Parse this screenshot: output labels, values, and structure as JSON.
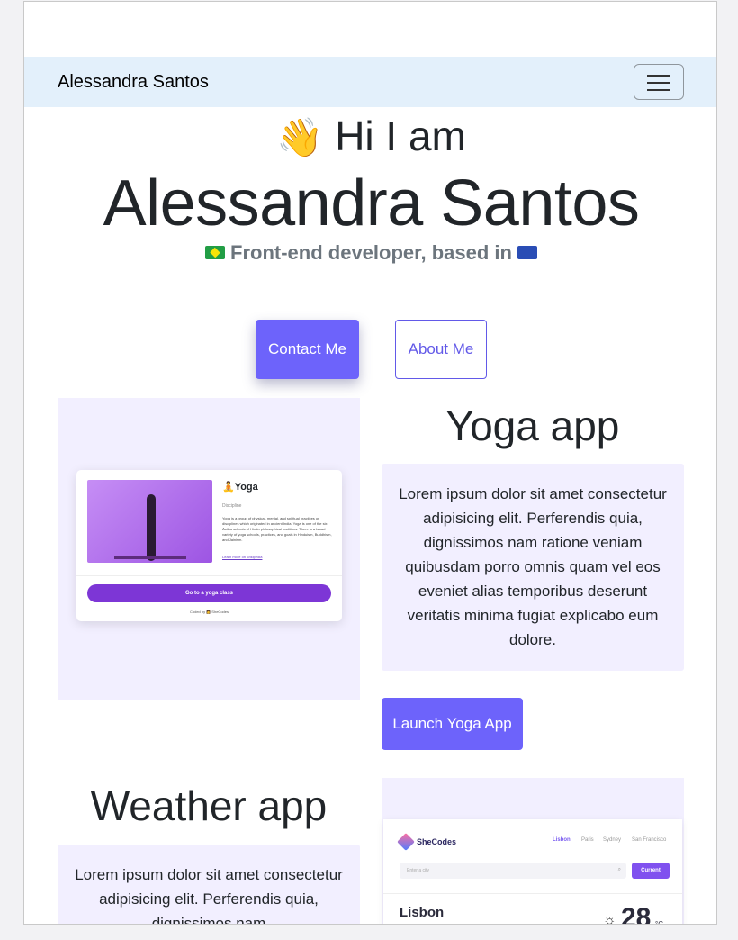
{
  "navbar": {
    "brand": "Alessandra Santos",
    "toggle_icon": "hamburger-icon"
  },
  "hero": {
    "greeting_emoji": "👋",
    "greeting": "Hi I am",
    "name": "Alessandra Santos",
    "subtitle": "Front-end developer, based in",
    "flag_left": "brazil-flag-icon",
    "flag_right": "eu-flag-icon",
    "contact_label": "Contact Me",
    "about_label": "About Me"
  },
  "projects": {
    "yoga": {
      "title": "Yoga app",
      "description": "Lorem ipsum dolor sit amet consectetur adipisicing elit. Perferendis quia, dignissimos nam ratione veniam quibusdam porro omnis quam vel eos eveniet alias temporibus deserunt veritatis minima fugiat explicabo eum dolore.",
      "launch_label": "Launch Yoga App",
      "screenshot": {
        "title": "🧘Yoga",
        "label": "Discipline",
        "text": "Yoga is a group of physical, mental, and spiritual practices or disciplines which originated in ancient India. Yoga is one of the six Āstika schools of Hindu philosophical traditions. There is a broad variety of yoga schools, practices, and goals in Hinduism, Buddhism, and Jainism.",
        "link": "Learn more on Wikipedia",
        "button": "Go to a yoga class",
        "coded_by": "Coded by 👩 SheCodes"
      }
    },
    "weather": {
      "title": "Weather app",
      "description": "Lorem ipsum dolor sit amet consectetur adipisicing elit. Perferendis quia, dignissimos nam",
      "screenshot": {
        "brand": "SheCodes",
        "cities": [
          "Lisbon",
          "Paris",
          "Sydney",
          "San Francisco"
        ],
        "search_placeholder": "Enter a city",
        "current_label": "Current",
        "city": "Lisbon",
        "temperature": "28",
        "unit": "°C"
      }
    }
  }
}
